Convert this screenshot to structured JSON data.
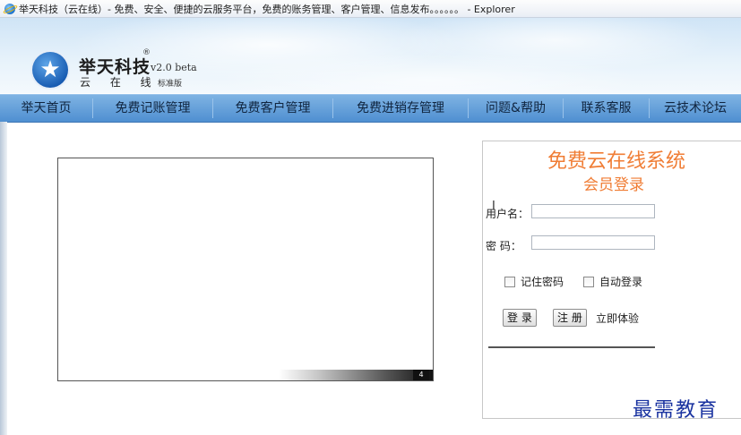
{
  "window": {
    "title": "举天科技（云在线）- 免费、安全、便捷的云服务平台，免费的账务管理、客户管理、信息发布。。。。。。 - Explorer",
    "icon": "ie-browser-icon"
  },
  "header": {
    "logo_icon": "star-logo-icon",
    "brand": "举天科技",
    "registered": "®",
    "version": "v2.0 beta",
    "subtitle": "云 在 线",
    "edition": "标准版"
  },
  "nav": {
    "items": [
      {
        "label": "举天首页"
      },
      {
        "label": "免费记账管理"
      },
      {
        "label": "免费客户管理"
      },
      {
        "label": "免费进销存管理"
      },
      {
        "label": "问题&帮助"
      },
      {
        "label": "联系客服"
      },
      {
        "label": "云技术论坛"
      }
    ]
  },
  "slideshow": {
    "page_number": "4"
  },
  "login": {
    "title": "免费云在线系统",
    "subtitle": "会员登录",
    "username_label": "用户名：",
    "username_value": "",
    "password_label": "密  码：",
    "password_value": "",
    "remember_label": "记住密码",
    "auto_login_label": "自动登录",
    "login_button": "登 录",
    "register_button": "注 册",
    "trial_link": "立即体验"
  },
  "watermark": "最需教育",
  "colors": {
    "nav_bg": "#5f9ad8",
    "login_title": "#f07d35",
    "watermark": "#1a33a0"
  }
}
